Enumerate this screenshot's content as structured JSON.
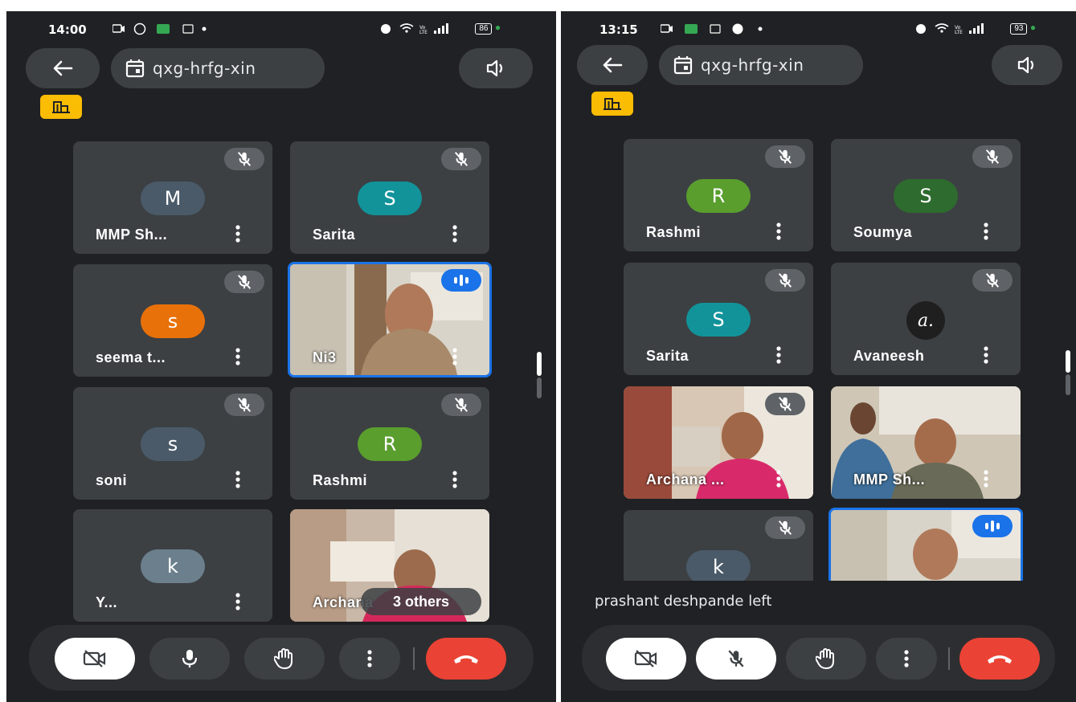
{
  "meeting_code": "qxg-hrfg-xin",
  "left": {
    "status_time": "14:00",
    "battery": "86",
    "tiles": [
      {
        "name": "MMP Sh...",
        "avatar": "M",
        "color": "#4a5a68",
        "mic_off": true
      },
      {
        "name": "Sarita",
        "avatar": "S",
        "color": "#12939a",
        "mic_off": true
      },
      {
        "name": "seema t...",
        "avatar": "s",
        "color": "#e8710a",
        "mic_off": true
      },
      {
        "name": "Ni3",
        "video": true,
        "speaking": true
      },
      {
        "name": "soni",
        "avatar": "s",
        "color": "#4a5a68",
        "mic_off": true
      },
      {
        "name": "Rashmi",
        "avatar": "R",
        "color": "#5a9e2e",
        "mic_off": true
      },
      {
        "name": "Y...",
        "avatar": "k",
        "color": "#6b7f8c",
        "mic_off": false
      },
      {
        "name": "Archana",
        "others": "3 others",
        "video": true
      }
    ]
  },
  "right": {
    "status_time": "13:15",
    "battery": "93",
    "tiles": [
      {
        "name": "Rashmi",
        "avatar": "R",
        "color": "#5a9e2e",
        "mic_off": true
      },
      {
        "name": "Soumya",
        "avatar": "S",
        "color": "#2e6b2e",
        "mic_off": true
      },
      {
        "name": "Sarita",
        "avatar": "S",
        "color": "#12939a",
        "mic_off": true
      },
      {
        "name": "Avaneesh",
        "avatar": "a.",
        "color": "#1f1f1f",
        "mic_off": true
      },
      {
        "name": "Archana ...",
        "video": true,
        "mic_off": true
      },
      {
        "name": "MMP Sh...",
        "video": true
      },
      {
        "avatar": "k",
        "color": "#4a5a68",
        "mic_off": true
      },
      {
        "video": true,
        "speaking": true
      }
    ],
    "toast": "prashant deshpande left"
  },
  "icons": {
    "back": "back-arrow-icon",
    "calendar": "calendar-icon",
    "speaker": "speaker-icon",
    "breakout": "breakout-room-icon",
    "camera_off": "camera-off-icon",
    "mic": "mic-icon",
    "mic_off": "mic-off-icon",
    "hand": "raise-hand-icon",
    "more": "more-vert-icon",
    "end_call": "end-call-icon"
  },
  "colors": {
    "background": "#202124",
    "tile": "#3c4043",
    "accent": "#1a73e8",
    "end_call": "#ea4335",
    "breakout": "#fbbc04"
  }
}
